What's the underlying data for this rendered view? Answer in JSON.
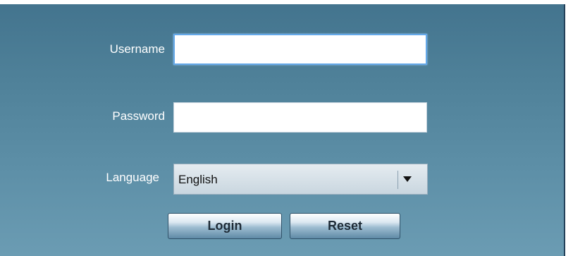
{
  "login_form": {
    "username": {
      "label": "Username",
      "value": ""
    },
    "password": {
      "label": "Password",
      "value": ""
    },
    "language": {
      "label": "Language",
      "selected": "English",
      "icon": "chevron-down-icon"
    },
    "buttons": {
      "login": "Login",
      "reset": "Reset"
    }
  },
  "colors": {
    "panel_top": "#43748e",
    "panel_bottom": "#6b9cb3",
    "focus_border": "#64a8e8"
  }
}
